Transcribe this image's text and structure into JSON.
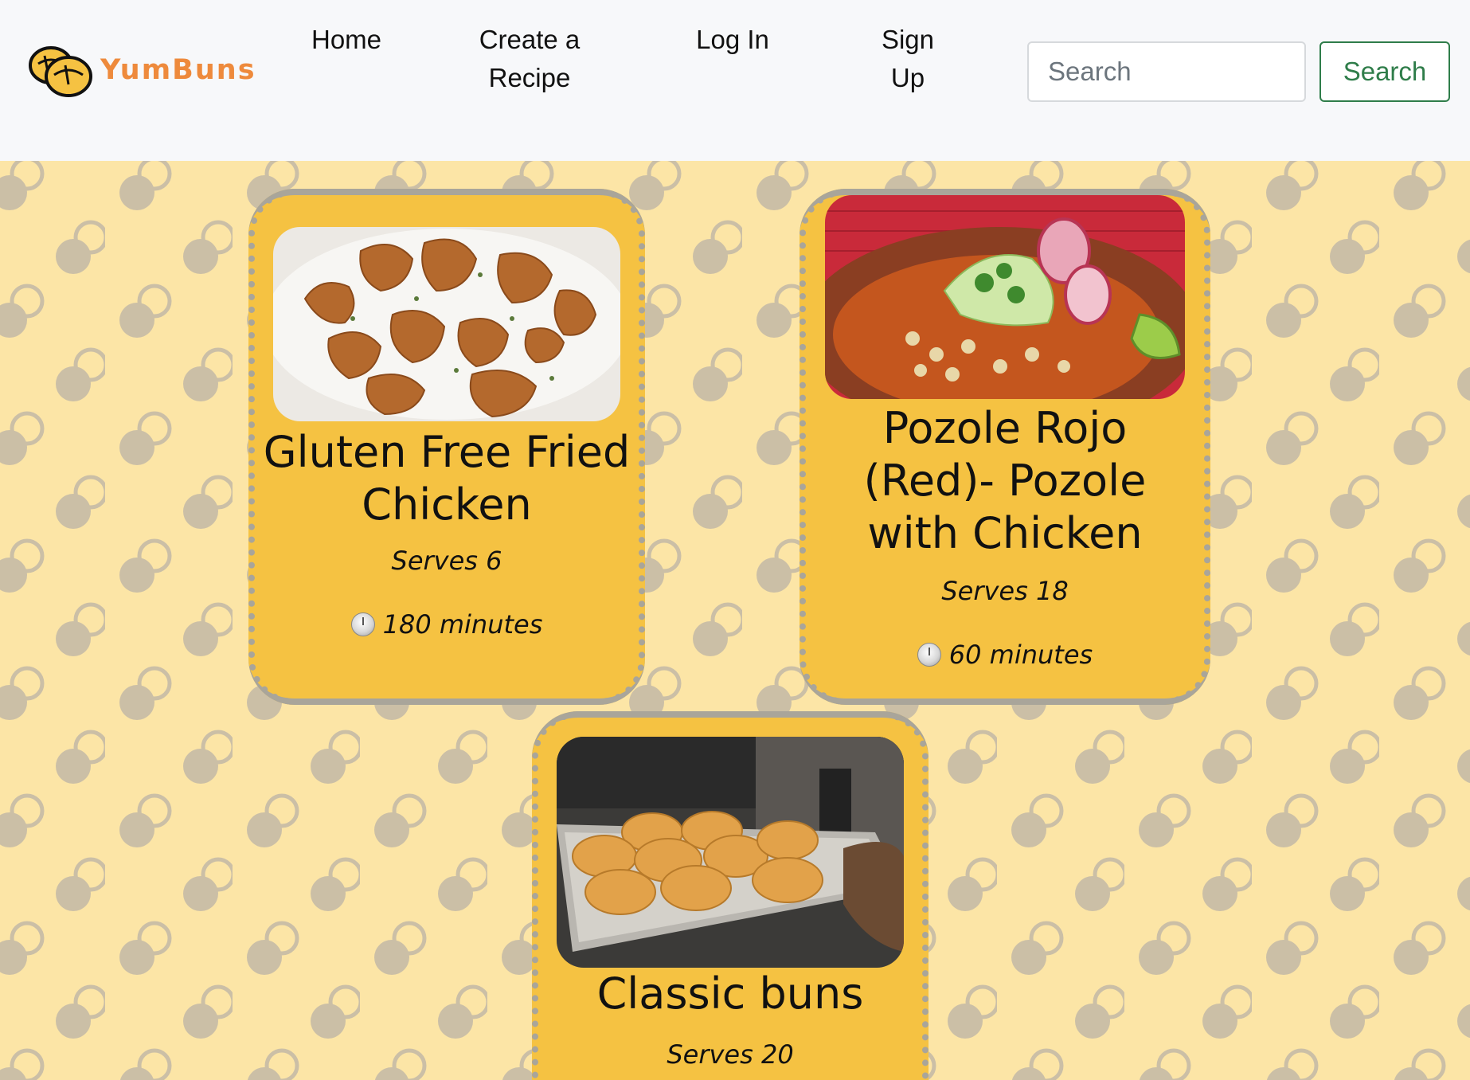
{
  "brand": {
    "name": "YumBuns",
    "logo_icon": "buns-logo-icon",
    "accent_color": "#ee8a3c"
  },
  "nav": {
    "links": [
      {
        "label": "Home"
      },
      {
        "label": "Create a Recipe"
      },
      {
        "label": "Log In"
      },
      {
        "label": "Sign Up"
      }
    ]
  },
  "search": {
    "placeholder": "Search",
    "button_label": "Search",
    "button_color": "#2f7d4a"
  },
  "recipes": [
    {
      "title": "Gluten Free Fried Chicken",
      "serves": "Serves 6",
      "time": "180 minutes",
      "image": "fried-chicken-photo"
    },
    {
      "title": "Pozole Rojo (Red)- Pozole with Chicken",
      "serves": "Serves 18",
      "time": "60 minutes",
      "image": "pozole-bowl-photo"
    },
    {
      "title": "Classic buns",
      "serves": "Serves 20",
      "image": "buns-tray-photo"
    }
  ],
  "colors": {
    "card_background": "#f5c242",
    "page_background": "#fce5a6",
    "pattern": "#cbbfa6"
  }
}
